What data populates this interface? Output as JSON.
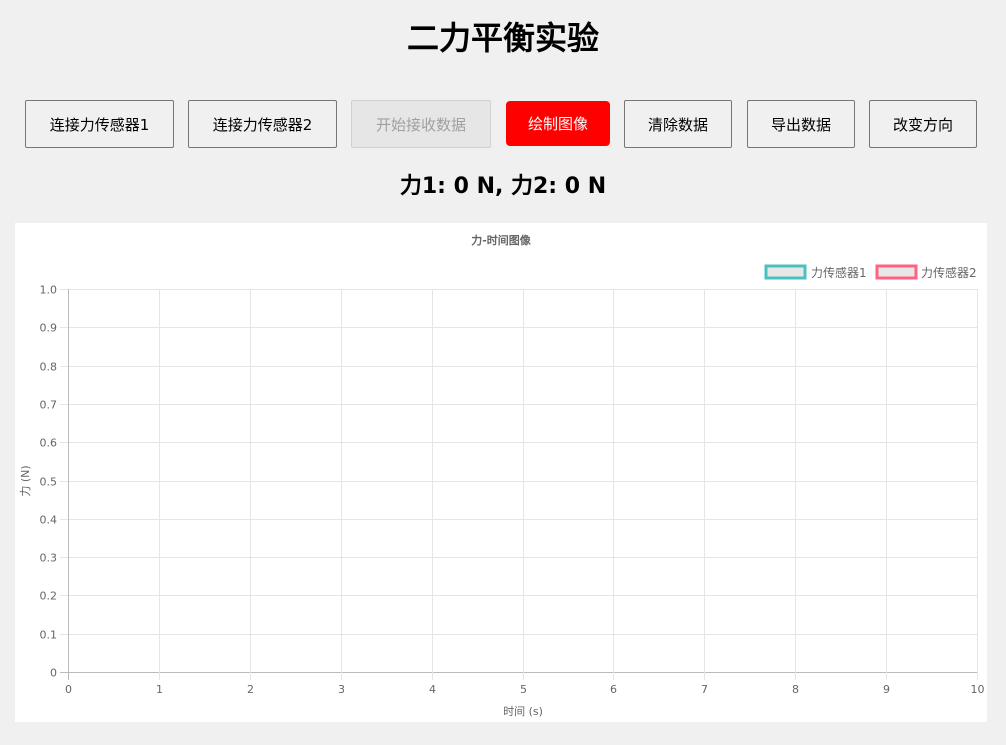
{
  "page": {
    "title": "二力平衡实验",
    "force_readout": "力1: 0 N, 力2: 0 N"
  },
  "toolbar": {
    "connect_sensor1": "连接力传感器1",
    "connect_sensor2": "连接力传感器2",
    "start_receive": "开始接收数据",
    "draw_chart": "绘制图像",
    "clear_data": "清除数据",
    "export_data": "导出数据",
    "change_direction": "改变方向"
  },
  "colors": {
    "draw_button": "#ff0000",
    "series1": "#4bc0c0",
    "series2": "#ff6384"
  },
  "chart_data": {
    "type": "line",
    "title": "力-时间图像",
    "xlabel": "时间 (s)",
    "ylabel": "力 (N)",
    "xlim": [
      0,
      10
    ],
    "ylim": [
      0,
      1
    ],
    "x_ticks": [
      "0",
      "1",
      "2",
      "3",
      "4",
      "5",
      "6",
      "7",
      "8",
      "9",
      "10"
    ],
    "y_ticks": [
      "0",
      "0.1",
      "0.2",
      "0.3",
      "0.4",
      "0.5",
      "0.6",
      "0.7",
      "0.8",
      "0.9",
      "1.0"
    ],
    "grid": true,
    "legend_position": "top-right",
    "series": [
      {
        "name": "力传感器1",
        "color": "#4bc0c0",
        "x": [],
        "values": []
      },
      {
        "name": "力传感器2",
        "color": "#ff6384",
        "x": [],
        "values": []
      }
    ]
  }
}
